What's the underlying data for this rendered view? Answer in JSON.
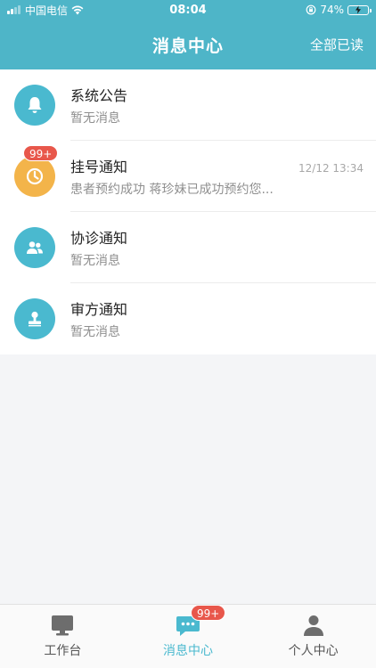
{
  "status_bar": {
    "carrier": "中国电信",
    "time": "08:04",
    "battery": "74%",
    "battery_level": 0.74
  },
  "header": {
    "title": "消息中心",
    "action": "全部已读"
  },
  "colors": {
    "primary": "#4eb5c8",
    "accent_teal": "#4ab9cf",
    "accent_orange": "#f3b44a",
    "badge_red": "#e8574b"
  },
  "messages": [
    {
      "icon": "bell-icon",
      "title": "系统公告",
      "subtitle": "暂无消息",
      "time": "",
      "badge": ""
    },
    {
      "icon": "clock-icon",
      "title": "挂号通知",
      "subtitle": "患者预约成功 蒋珍妹已成功预约您...",
      "time": "12/12 13:34",
      "badge": "99+"
    },
    {
      "icon": "people-icon",
      "title": "协诊通知",
      "subtitle": "暂无消息",
      "time": "",
      "badge": ""
    },
    {
      "icon": "stamp-icon",
      "title": "审方通知",
      "subtitle": "暂无消息",
      "time": "",
      "badge": ""
    }
  ],
  "tabs": [
    {
      "icon": "monitor-icon",
      "label": "工作台",
      "badge": ""
    },
    {
      "icon": "chat-icon",
      "label": "消息中心",
      "badge": "99+",
      "active": true
    },
    {
      "icon": "person-icon",
      "label": "个人中心",
      "badge": ""
    }
  ]
}
